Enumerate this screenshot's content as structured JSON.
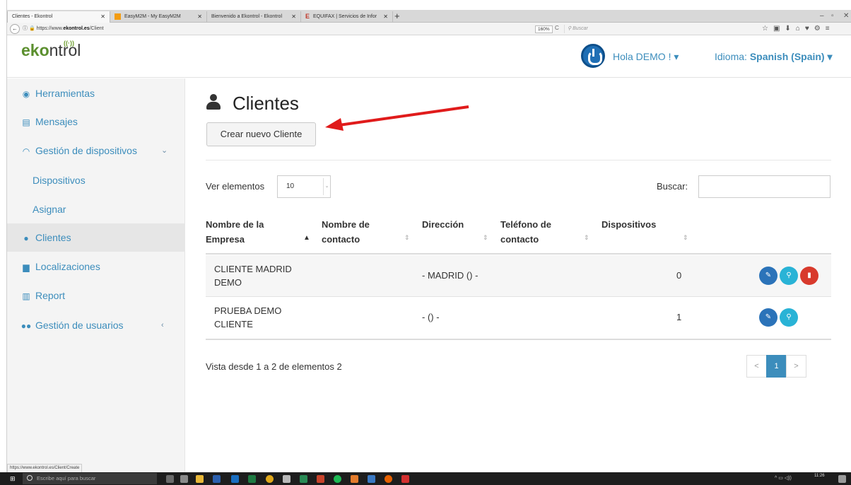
{
  "browser": {
    "tabs": [
      {
        "title": "Clientes - Ekontrol"
      },
      {
        "title": "EasyM2M - My EasyM2M"
      },
      {
        "title": "Bienvenido a Ekontrol - Ekontrol"
      },
      {
        "title": "EQUIFAX | Servicios de Infor"
      }
    ],
    "new_tab": "+",
    "url_prefix": "https://www.",
    "url_domain": "ekontrol.es",
    "url_path": "/Client",
    "zoom": "160%",
    "search_placeholder": "Buscar",
    "status_url": "https://www.ekontrol.es/Client/Create"
  },
  "header": {
    "logo_eko": "eko",
    "logo_ntrol": "ntrol",
    "greeting": "Hola DEMO ! ▾",
    "language_label": "Idioma: ",
    "language_value": "Spanish (Spain) ▾"
  },
  "sidebar": {
    "items": [
      {
        "label": "Herramientas",
        "icon": "dashboard-icon"
      },
      {
        "label": "Mensajes",
        "icon": "messages-icon"
      },
      {
        "label": "Gestión de dispositivos",
        "icon": "wifi-icon"
      },
      {
        "label": "Dispositivos"
      },
      {
        "label": "Asignar"
      },
      {
        "label": "Clientes",
        "icon": "user-icon"
      },
      {
        "label": "Localizaciones",
        "icon": "building-icon"
      },
      {
        "label": "Report",
        "icon": "bar-chart-icon"
      },
      {
        "label": "Gestión de usuarios",
        "icon": "users-icon"
      }
    ]
  },
  "main": {
    "title": "Clientes",
    "create_button": "Crear nuevo Cliente",
    "page_size_label": "Ver elementos",
    "page_size_value": "10",
    "search_label": "Buscar:",
    "columns": [
      {
        "line1": "Nombre de la",
        "line2": "Empresa"
      },
      {
        "line1": "Nombre de",
        "line2": "contacto"
      },
      {
        "line1": "",
        "line2": "Dirección"
      },
      {
        "line1": "Teléfono de",
        "line2": "contacto"
      },
      {
        "line1": "",
        "line2": "Dispositivos"
      }
    ],
    "rows": [
      {
        "company_line1": "CLIENTE MADRID",
        "company_line2": "DEMO",
        "contact": "",
        "address": "- MADRID () -",
        "phone": "",
        "devices": "0"
      },
      {
        "company_line1": "PRUEBA DEMO",
        "company_line2": "CLIENTE",
        "contact": "",
        "address": "- () -",
        "phone": "",
        "devices": "1"
      }
    ],
    "info": "Vista desde 1 a 2 de elementos 2",
    "pager": {
      "prev": "<",
      "current": "1",
      "next": ">"
    }
  },
  "taskbar": {
    "search_placeholder": "Escribe aquí para buscar",
    "time": "11:26"
  },
  "colors": {
    "link_blue": "#3c8dbc",
    "brand_green": "#5b8f2e",
    "annotation_arrow": "#e01b1b"
  }
}
